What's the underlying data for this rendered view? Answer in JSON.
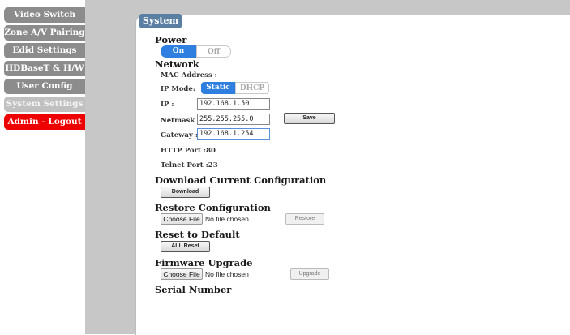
{
  "sidebar": {
    "items": [
      {
        "label": "Video Switch"
      },
      {
        "label": "Zone A/V Pairing"
      },
      {
        "label": "Edid Settings"
      },
      {
        "label": "HDBaseT & H/W"
      },
      {
        "label": "User Config"
      },
      {
        "label": "System Settings"
      },
      {
        "label": "Admin - Logout"
      }
    ]
  },
  "panel": {
    "title": "System"
  },
  "power": {
    "heading": "Power",
    "on": "On",
    "off": "Off",
    "state": "On"
  },
  "network": {
    "heading": "Network",
    "mac_label": "MAC Address :",
    "ip_mode_label": "IP Mode:",
    "ip_mode_static": "Static",
    "ip_mode_dhcp": "DHCP",
    "ip_mode_state": "Static",
    "ip_label": "IP :",
    "ip_value": "192.168.1.50",
    "netmask_label": "Netmask :",
    "netmask_value": "255.255.255.0",
    "gateway_label": "Gateway :",
    "gateway_value": "192.168.1.254",
    "save_label": "Save",
    "http_port": "HTTP Port :80",
    "telnet_port": "Telnet Port :23"
  },
  "download": {
    "heading": "Download Current Configuration",
    "button": "Download"
  },
  "restore": {
    "heading": "Restore Configuration",
    "choose": "Choose File",
    "chosen": "No file chosen",
    "button": "Restore"
  },
  "reset": {
    "heading": "Reset to Default",
    "button": "ALL Reset"
  },
  "firmware": {
    "heading": "Firmware Upgrade",
    "choose": "Choose File",
    "chosen": "No file chosen",
    "button": "Upgrade"
  },
  "serial": {
    "heading": "Serial Number"
  },
  "colors": {
    "nav": "#8c8c8c",
    "nav_selected": "#c0c0c0",
    "logout": "#ee0000",
    "title_tab": "#5b7fa3",
    "toggle_on": "#2f7fe0"
  }
}
